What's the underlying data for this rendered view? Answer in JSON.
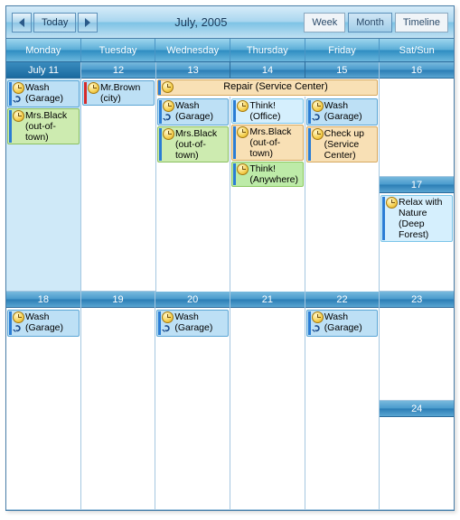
{
  "header": {
    "today_label": "Today",
    "title": "July, 2005",
    "views": {
      "week": "Week",
      "month": "Month",
      "timeline": "Timeline"
    },
    "active_view": "month"
  },
  "day_headers": [
    "Monday",
    "Tuesday",
    "Wednesday",
    "Thursday",
    "Friday",
    "Sat/Sun"
  ],
  "weeks": [
    {
      "dates": [
        "July 11",
        "12",
        "13",
        "14",
        "15",
        "16",
        "17"
      ],
      "selected_index": 0
    },
    {
      "dates": [
        "18",
        "19",
        "20",
        "21",
        "22",
        "23",
        "24"
      ]
    }
  ],
  "banner": {
    "text": "Repair (Service Center)"
  },
  "appts": {
    "wash": "Wash (Garage)",
    "mrbrown": "Mr.Brown (city)",
    "mrsblack": "Mrs.Black (out-of-town)",
    "think_office": "Think! (Office)",
    "think_any": "Think! (Anywhere)",
    "checkup": "Check up (Service Center)",
    "relax": "Relax with Nature (Deep Forest)"
  }
}
